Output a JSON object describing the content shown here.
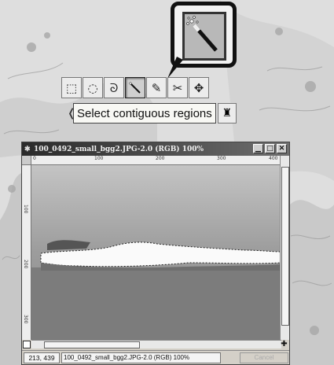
{
  "callout": {
    "tool_icon": "magic-wand-icon"
  },
  "toolbox": {
    "tools": [
      {
        "name": "rect-select-icon",
        "glyph": "⬚"
      },
      {
        "name": "ellipse-select-icon",
        "glyph": "◌"
      },
      {
        "name": "lasso-icon",
        "glyph": "ᘐ"
      },
      {
        "name": "magic-wand-icon",
        "glyph": "⸜"
      },
      {
        "name": "paths-icon",
        "glyph": "✎"
      },
      {
        "name": "scissors-icon",
        "glyph": "✂"
      },
      {
        "name": "move-icon",
        "glyph": "✥"
      }
    ],
    "tooltip": "Select contiguous regions",
    "extra_tool_icon": "stamp-icon"
  },
  "window": {
    "title": "100_0492_small_bgg2.JPG-2.0 (RGB) 100%",
    "ruler_labels": {
      "h": [
        "0",
        "100",
        "200",
        "300",
        "400"
      ],
      "v": [
        "100",
        "200",
        "300"
      ]
    },
    "status": {
      "coords": "213, 439",
      "text": "100_0492_small_bgg2.JPG-2.0 (RGB) 100%",
      "cancel": "Cancel"
    }
  }
}
